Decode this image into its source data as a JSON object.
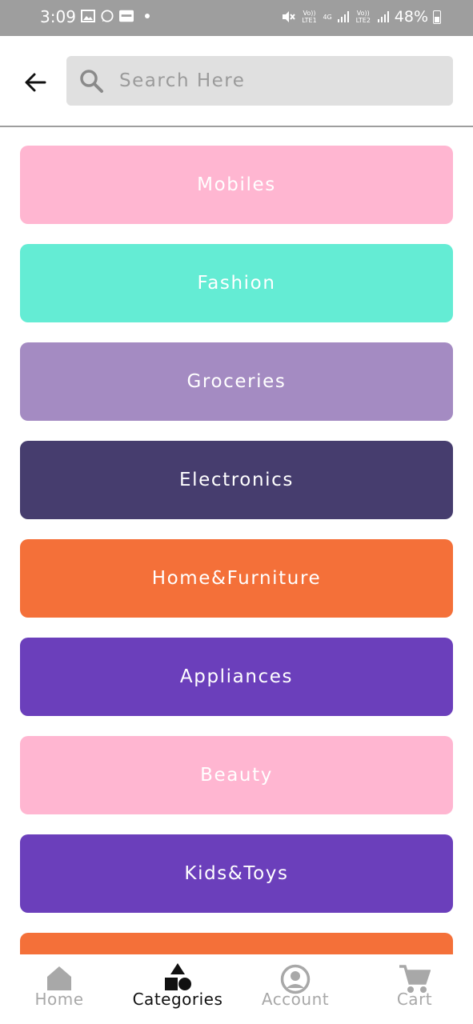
{
  "status_bar": {
    "time": "3:09",
    "battery": "48%",
    "sim1_label": "Vo)) LTE1",
    "net_label": "4G",
    "sim2_label": "Vo)) LTE2",
    "left_icons": [
      "gallery-icon",
      "whatsapp-icon",
      "paytm-icon",
      "dot-icon"
    ],
    "right_icons": [
      "mute-icon",
      "signal-icon",
      "signal-icon",
      "battery-icon"
    ]
  },
  "header": {
    "back_icon": "arrow-left-icon",
    "search": {
      "icon": "search-icon",
      "placeholder": "Search Here",
      "value": ""
    }
  },
  "categories": [
    {
      "label": "Mobiles",
      "color": "#ffb6d1"
    },
    {
      "label": "Fashion",
      "color": "#64ecd4"
    },
    {
      "label": "Groceries",
      "color": "#a48bc2"
    },
    {
      "label": "Electronics",
      "color": "#463d6e"
    },
    {
      "label": "Home&Furniture",
      "color": "#f47039"
    },
    {
      "label": "Appliances",
      "color": "#6b3fbb"
    },
    {
      "label": "Beauty",
      "color": "#ffb6d1"
    },
    {
      "label": "Kids&Toys",
      "color": "#6b3fbb"
    },
    {
      "label": "",
      "color": "#f47039"
    }
  ],
  "bottom_nav": {
    "items": [
      {
        "label": "Home",
        "icon": "home-icon",
        "active": false
      },
      {
        "label": "Categories",
        "icon": "shapes-icon",
        "active": true
      },
      {
        "label": "Account",
        "icon": "account-icon",
        "active": false
      },
      {
        "label": "Cart",
        "icon": "cart-icon",
        "active": false
      }
    ]
  },
  "colors": {
    "status_bar": "#9e9e9e",
    "search_bg": "#e0e0e0",
    "nav_active": "#111111",
    "nav_inactive": "#a8a8a8"
  }
}
